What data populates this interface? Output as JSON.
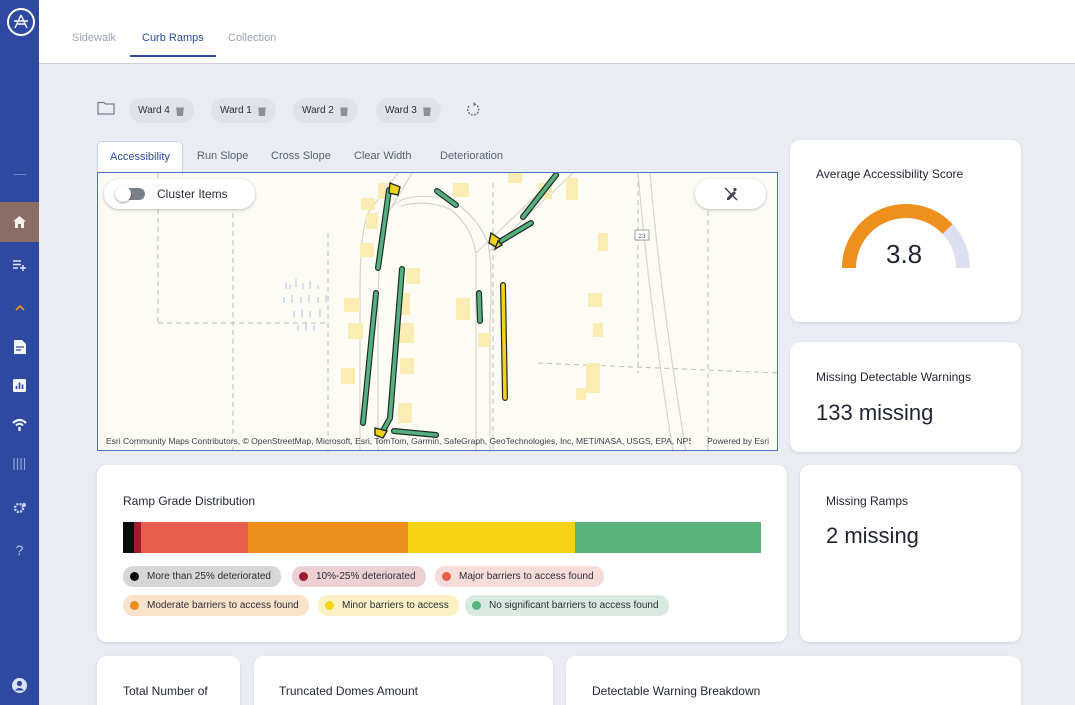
{
  "sidebar": {
    "items": [
      {
        "name": "home-icon",
        "active": true
      },
      {
        "name": "playlist-add-icon"
      },
      {
        "name": "chevron-up-icon"
      },
      {
        "name": "report-icon"
      },
      {
        "name": "bar-chart-icon"
      },
      {
        "name": "signal-icon"
      },
      {
        "name": "tune-icon"
      },
      {
        "name": "settings-icon"
      },
      {
        "name": "help-icon"
      },
      {
        "name": "account-icon"
      }
    ]
  },
  "top_tabs": [
    {
      "label": "Sidewalk",
      "active": false
    },
    {
      "label": "Curb Ramps",
      "active": true
    },
    {
      "label": "Collection",
      "active": false
    }
  ],
  "wards": [
    {
      "label": "Ward 4"
    },
    {
      "label": "Ward 1"
    },
    {
      "label": "Ward 2"
    },
    {
      "label": "Ward 3"
    }
  ],
  "map_tabs": [
    {
      "label": "Accessibility",
      "active": true
    },
    {
      "label": "Run Slope"
    },
    {
      "label": "Cross Slope"
    },
    {
      "label": "Clear Width"
    },
    {
      "label": "Deterioration"
    }
  ],
  "map": {
    "cluster_label": "Cluster Items",
    "cluster_enabled": false,
    "attribution": "Esri Community Maps Contributors, © OpenStreetMap, Microsoft, Esri, TomTom, Garmin, SafeGraph, GeoTechnologies, Inc, METI/NASA, USGS, EPA, NPS, US Census Bureau, USDA, USFWS",
    "powered_by": "Powered by Esri",
    "road_label": "23"
  },
  "score_card": {
    "title": "Average Accessibility Score",
    "value": "3.8",
    "gauge_fraction": 0.76,
    "gauge_color": "#ef8f1c",
    "gauge_track_color": "#dcdff0"
  },
  "warnings_card": {
    "title": "Missing Detectable Warnings",
    "value": "133 missing"
  },
  "ramps_card": {
    "title": "Missing Ramps",
    "value": "2 missing"
  },
  "distribution": {
    "title": "Ramp Grade Distribution",
    "segments": [
      {
        "label": "More than 25% deteriorated",
        "fraction": 0.017,
        "color": "#0a0a0a",
        "pill_bg": "#d6d6d6"
      },
      {
        "label": "10%-25% deteriorated",
        "fraction": 0.011,
        "color": "#a01a2e",
        "pill_bg": "#ecd0d4"
      },
      {
        "label": "Major barriers to access found",
        "fraction": 0.168,
        "color": "#e85d4e",
        "pill_bg": "#f8dcd8"
      },
      {
        "label": "Moderate barriers to access found",
        "fraction": 0.251,
        "color": "#ee8f1b",
        "pill_bg": "#fbe2cb"
      },
      {
        "label": "Minor barriers to access",
        "fraction": 0.261,
        "color": "#f7d316",
        "pill_bg": "#fbf1c4"
      },
      {
        "label": "No significant barriers to access found",
        "fraction": 0.292,
        "color": "#58b47b",
        "pill_bg": "#d8eadf"
      }
    ]
  },
  "bottom_cards": [
    {
      "title": "Total Number of"
    },
    {
      "title": "Truncated Domes Amount"
    },
    {
      "title": "Detectable Warning Breakdown"
    }
  ]
}
